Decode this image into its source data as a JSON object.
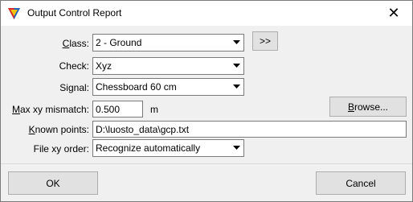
{
  "window": {
    "title": "Output Control Report",
    "close_symbol": "✕",
    "icon": "terrasolid-tool-icon"
  },
  "form": {
    "class": {
      "label_key": "C",
      "label_rest": "lass:",
      "value": "2 - Ground"
    },
    "expand_button": ">>",
    "check": {
      "label": "Check:",
      "value": "Xyz"
    },
    "signal": {
      "label": "Signal:",
      "value": "Chessboard 60 cm"
    },
    "max_xy": {
      "label_key": "M",
      "label_rest": "ax xy mismatch:",
      "value": "0.500",
      "unit": "m"
    },
    "browse_key": "B",
    "browse_rest": "rowse...",
    "known_points": {
      "label_key": "K",
      "label_rest": "nown points:",
      "value": "D:\\luosto_data\\gcp.txt"
    },
    "file_xy_order": {
      "label": "File xy order:",
      "value": "Recognize automatically"
    }
  },
  "footer": {
    "ok_label": "OK",
    "cancel_label": "Cancel"
  }
}
